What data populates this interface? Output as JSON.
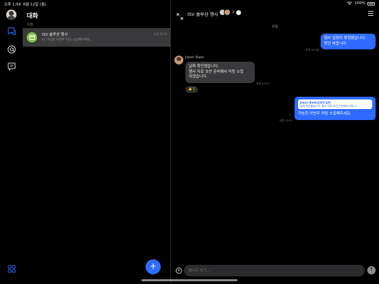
{
  "status": {
    "time": "오후 1:59",
    "date": "6월 12일 (월)",
    "battery": "100%"
  },
  "sidebar_rail": {
    "icons": [
      "chat-bubbles-icon",
      "at-mention-icon",
      "message-square-icon",
      "grid-apps-icon"
    ]
  },
  "list": {
    "title": "대화",
    "section": "오늘",
    "conversations": [
      {
        "name": "ISV 솔루션 행사",
        "preview": "나: 가능한 이번주 미팅 소집해주세요.",
        "time": "오후 12:41",
        "avatar_color": "#8bc34a"
      }
    ],
    "fab": "+"
  },
  "chat": {
    "title": "ISV 솔루션 행사",
    "member_count": "2",
    "date_separator": "오늘",
    "messages": [
      {
        "id": "m1",
        "mine": true,
        "text_lines": [
          "행사 일정이 확정됐습니다.",
          "확인 바랍니다."
        ],
        "time": "오후 12:38"
      },
      {
        "id": "m2",
        "mine": false,
        "sender": "Jiwon Baek",
        "text_lines": [
          "날짜 확인했습니다.",
          "행사 자료 초안 준비해서 미팅 소집",
          "하겠습니다."
        ],
        "time": "오후 12:41",
        "reaction": "👍 1"
      },
      {
        "id": "m3",
        "mine": true,
        "reply_to": {
          "title": "Jiwon Baek님에게 답장",
          "body": "날짜 확인했습니다. 행사 자료 초안 준비해서 미팅 소…"
        },
        "text": "가능한 이번주 미팅 소집해주세요.",
        "time": "오후 12:42",
        "read_mark": "✓"
      }
    ],
    "composer": {
      "placeholder": "메시지 쓰기...",
      "add": "+",
      "send": "↑"
    }
  },
  "colors": {
    "accent": "#2f6bff",
    "bubble_theirs": "#3a3a3c",
    "selected_row": "#3a3a3c"
  }
}
